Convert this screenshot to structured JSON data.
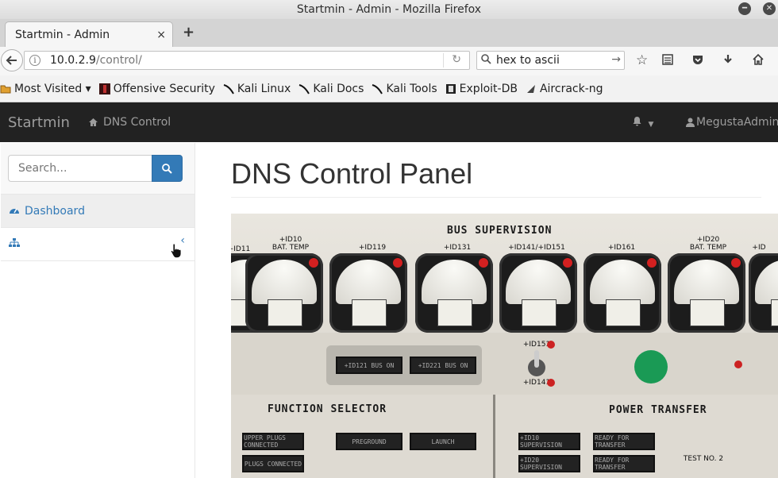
{
  "window": {
    "title": "Startmin - Admin - Mozilla Firefox"
  },
  "tab": {
    "title": "Startmin - Admin",
    "close": "×",
    "new": "+"
  },
  "urlbar": {
    "host": "10.0.2.9",
    "path": "/control/"
  },
  "searchbar": {
    "value": "hex to ascii"
  },
  "bookmarks": [
    {
      "label": "Most Visited ▾",
      "icon": "folder-icon"
    },
    {
      "label": "Offensive Security",
      "icon": "offsec-icon"
    },
    {
      "label": "Kali Linux",
      "icon": "kali-icon"
    },
    {
      "label": "Kali Docs",
      "icon": "kali-icon"
    },
    {
      "label": "Kali Tools",
      "icon": "kali-icon"
    },
    {
      "label": "Exploit-DB",
      "icon": "exploitdb-icon"
    },
    {
      "label": "Aircrack-ng",
      "icon": "aircrack-icon"
    }
  ],
  "app": {
    "brand": "Startmin",
    "nav_link": "DNS Control",
    "user": "MegustaAdmin"
  },
  "sidebar": {
    "search_placeholder": "Search...",
    "items": [
      {
        "label": "Dashboard",
        "icon": "dashboard-icon"
      },
      {
        "label": "",
        "icon": "sitemap-icon"
      }
    ]
  },
  "page": {
    "title": "DNS Control Panel",
    "image_labels": {
      "bus_supervision": "BUS SUPERVISION",
      "function_selector": "FUNCTION SELECTOR",
      "power_transfer": "POWER TRANSFER",
      "gauges": [
        "+ID11",
        "+ID10\nBAT. TEMP",
        "+ID119",
        "+ID131",
        "+ID141/+ID151",
        "+ID161",
        "+ID20\nBAT. TEMP",
        "+ID"
      ],
      "lamps": [
        "+ID121 BUS ON",
        "+ID221 BUS ON",
        "+ID151",
        "+ID141",
        "UPPER PLUGS CONNECTED",
        "PLUGS CONNECTED",
        "PREGROUND",
        "LAUNCH",
        "+ID10 SUPERVISION",
        "+ID20 SUPERVISION",
        "READY FOR TRANSFER",
        "READY FOR TRANSFER",
        "TEST NO. 2"
      ]
    }
  },
  "colors": {
    "accent": "#337ab7",
    "navbar": "#222222"
  }
}
